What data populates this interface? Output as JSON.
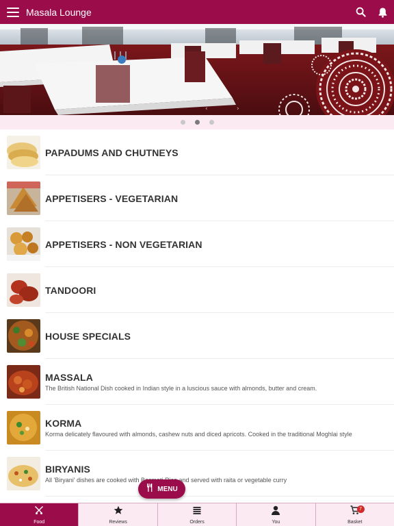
{
  "header": {
    "title": "Masala Lounge",
    "brand_color": "#9b0d4a"
  },
  "carousel": {
    "slide_count": 3,
    "active_index": 1
  },
  "categories": [
    {
      "title": "PAPADUMS AND CHUTNEYS",
      "description": ""
    },
    {
      "title": "APPETISERS - VEGETARIAN",
      "description": ""
    },
    {
      "title": "APPETISERS - NON VEGETARIAN",
      "description": ""
    },
    {
      "title": "TANDOORI",
      "description": ""
    },
    {
      "title": "HOUSE SPECIALS",
      "description": ""
    },
    {
      "title": "MASSALA",
      "description": "The British National Dish cooked in Indian style in a luscious sauce with almonds, butter and cream."
    },
    {
      "title": "KORMA",
      "description": "Korma delicately flavoured with almonds, cashew nuts and diced apricots. Cooked in the traditional Moghlai style"
    },
    {
      "title": "BIRYANIS",
      "description": "All 'Biryani' dishes are cooked with Basmati Rice and served with raita or vegetable curry"
    }
  ],
  "fab": {
    "label": "MENU"
  },
  "bottom_nav": [
    {
      "label": "Food",
      "icon": "fork-knife-icon",
      "active": true
    },
    {
      "label": "Reviews",
      "icon": "star-icon",
      "active": false
    },
    {
      "label": "Orders",
      "icon": "list-icon",
      "active": false
    },
    {
      "label": "You",
      "icon": "person-icon",
      "active": false
    },
    {
      "label": "Basket",
      "icon": "cart-icon",
      "active": false,
      "badge": "7"
    }
  ]
}
